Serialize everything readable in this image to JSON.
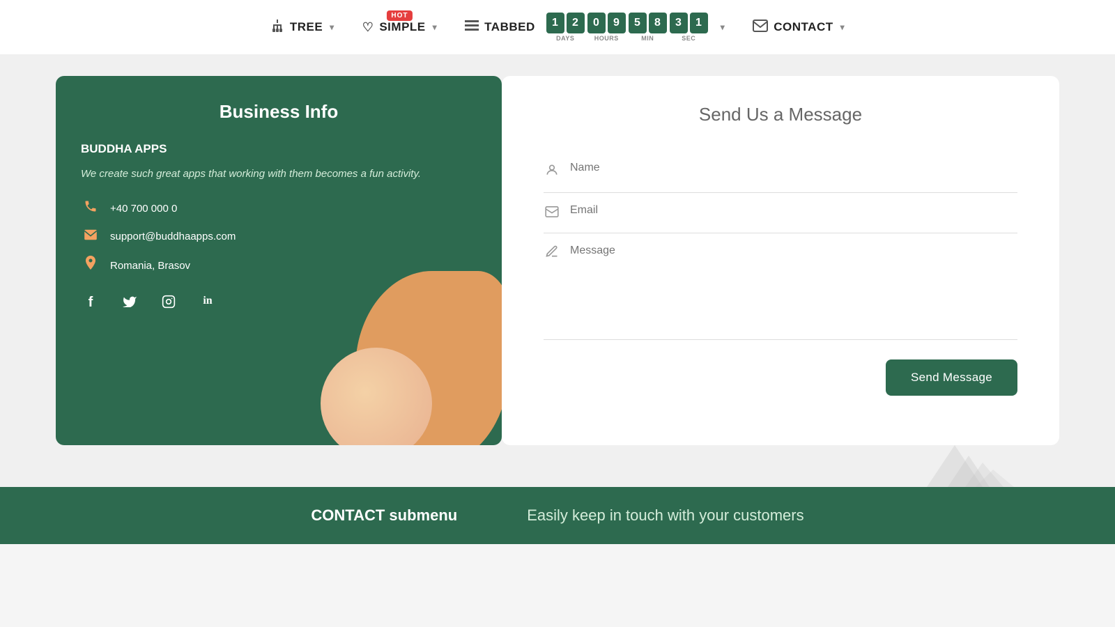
{
  "navbar": {
    "tree_label": "TREE",
    "simple_label": "SIMPLE",
    "tabbed_label": "TABBED",
    "contact_label": "CONTACT",
    "hot_badge": "HOT",
    "countdown": {
      "days": [
        "1",
        "2"
      ],
      "hours": [
        "0",
        "9"
      ],
      "minutes": [
        "5",
        "8"
      ],
      "seconds": [
        "3",
        "1"
      ],
      "days_label": "DAYS",
      "hours_label": "HOURS",
      "min_label": "MIN",
      "sec_label": "SEC"
    }
  },
  "business_card": {
    "title": "Business Info",
    "company_name": "BUDDHA APPS",
    "description": "We create such great apps that working with them becomes a fun activity.",
    "phone": "+40 700 000 0",
    "email": "support@buddhaapps.com",
    "address": "Romania, Brasov"
  },
  "contact_form": {
    "title": "Send Us a Message",
    "name_placeholder": "Name",
    "email_placeholder": "Email",
    "message_placeholder": "Message",
    "send_button": "Send Message"
  },
  "footer": {
    "left": "CONTACT submenu",
    "right": "Easily keep in touch with your customers"
  },
  "icons": {
    "tree": "⊞",
    "simple": "♡",
    "tabbed": "≡",
    "contact": "✉",
    "phone": "📞",
    "email": "✉",
    "location": "📍",
    "user": "👤",
    "message": "✏",
    "facebook": "f",
    "twitter": "t",
    "instagram": "◻",
    "linkedin": "in"
  }
}
